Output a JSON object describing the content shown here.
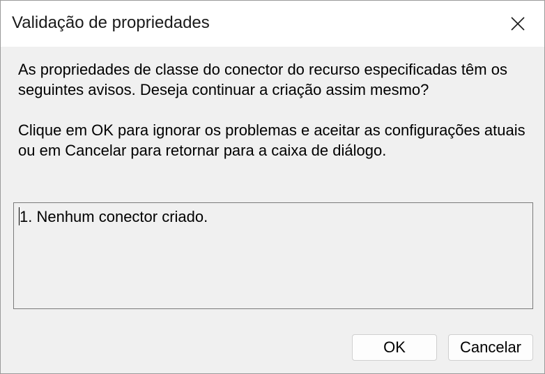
{
  "window": {
    "title": "Validação de propriedades"
  },
  "message": {
    "warning_intro": "As propriedades  de classe do conector do recurso especificadas têm os seguintes avisos. Deseja continuar a criação assim mesmo?",
    "instructions": "Clique em OK para ignorar os problemas e aceitar as configurações atuais ou em Cancelar para retornar para a caixa de diálogo."
  },
  "warnings": {
    "items": [
      "1. Nenhum conector criado."
    ]
  },
  "buttons": {
    "ok_label": "OK",
    "cancel_label": "Cancelar"
  },
  "icons": {
    "close": "close-icon"
  }
}
